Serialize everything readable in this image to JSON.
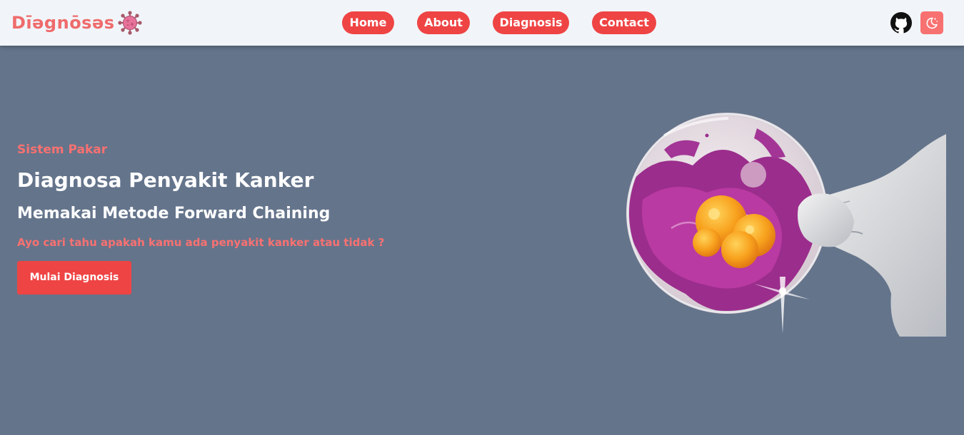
{
  "brand": {
    "name": "Dīəgnōsəs",
    "logo_icon": "virus-icon"
  },
  "nav": {
    "items": [
      {
        "label": "Home"
      },
      {
        "label": "About"
      },
      {
        "label": "Diagnosis"
      },
      {
        "label": "Contact"
      }
    ]
  },
  "header_actions": {
    "github_icon": "github-icon",
    "theme_icon": "moon-stars-icon"
  },
  "hero": {
    "subtitle": "Sistem Pakar",
    "title": "Diagnosa Penyakit Kanker",
    "method": "Memakai Metode Forward Chaining",
    "question": "Ayo cari tahu apakah kamu ada penyakit kanker atau tidak ?",
    "cta_label": "Mulai Diagnosis",
    "image_icon": "petri-dish-illustration"
  },
  "colors": {
    "accent": "#ef4444",
    "accent_light": "#f87171",
    "background": "#64748b",
    "navbar": "#f1f5f9"
  }
}
